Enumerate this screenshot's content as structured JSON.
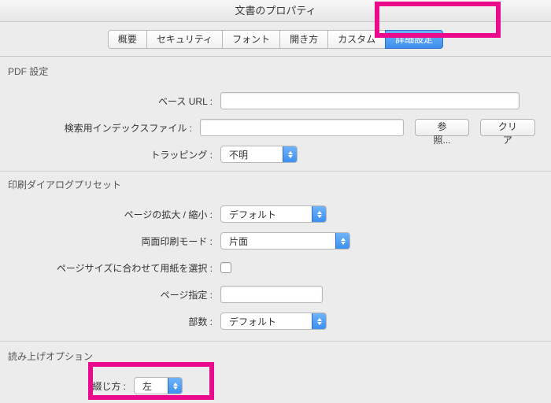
{
  "window": {
    "title": "文書のプロパティ"
  },
  "tabs": {
    "items": [
      {
        "label": "概要"
      },
      {
        "label": "セキュリティ"
      },
      {
        "label": "フォント"
      },
      {
        "label": "開き方"
      },
      {
        "label": "カスタム"
      },
      {
        "label": "詳細設定"
      }
    ],
    "active_index": 5
  },
  "sections": {
    "pdf_settings": {
      "title": "PDF 設定",
      "base_url": {
        "label": "ベース URL :",
        "value": ""
      },
      "index_file": {
        "label": "検索用インデックスファイル :",
        "value": "",
        "browse_btn": "参照...",
        "clear_btn": "クリア"
      },
      "trapping": {
        "label": "トラッピング :",
        "value": "不明"
      }
    },
    "print_preset": {
      "title": "印刷ダイアログプリセット",
      "page_scaling": {
        "label": "ページの拡大 / 縮小 :",
        "value": "デフォルト"
      },
      "duplex": {
        "label": "両面印刷モード :",
        "value": "片面"
      },
      "paper_by_page": {
        "label": "ページサイズに合わせて用紙を選択 :",
        "checked": false
      },
      "page_range": {
        "label": "ページ指定 :",
        "value": ""
      },
      "copies": {
        "label": "部数 :",
        "value": "デフォルト"
      }
    },
    "reading": {
      "title": "読み上げオプション",
      "binding": {
        "label": "綴じ方 :",
        "value": "左"
      }
    }
  }
}
